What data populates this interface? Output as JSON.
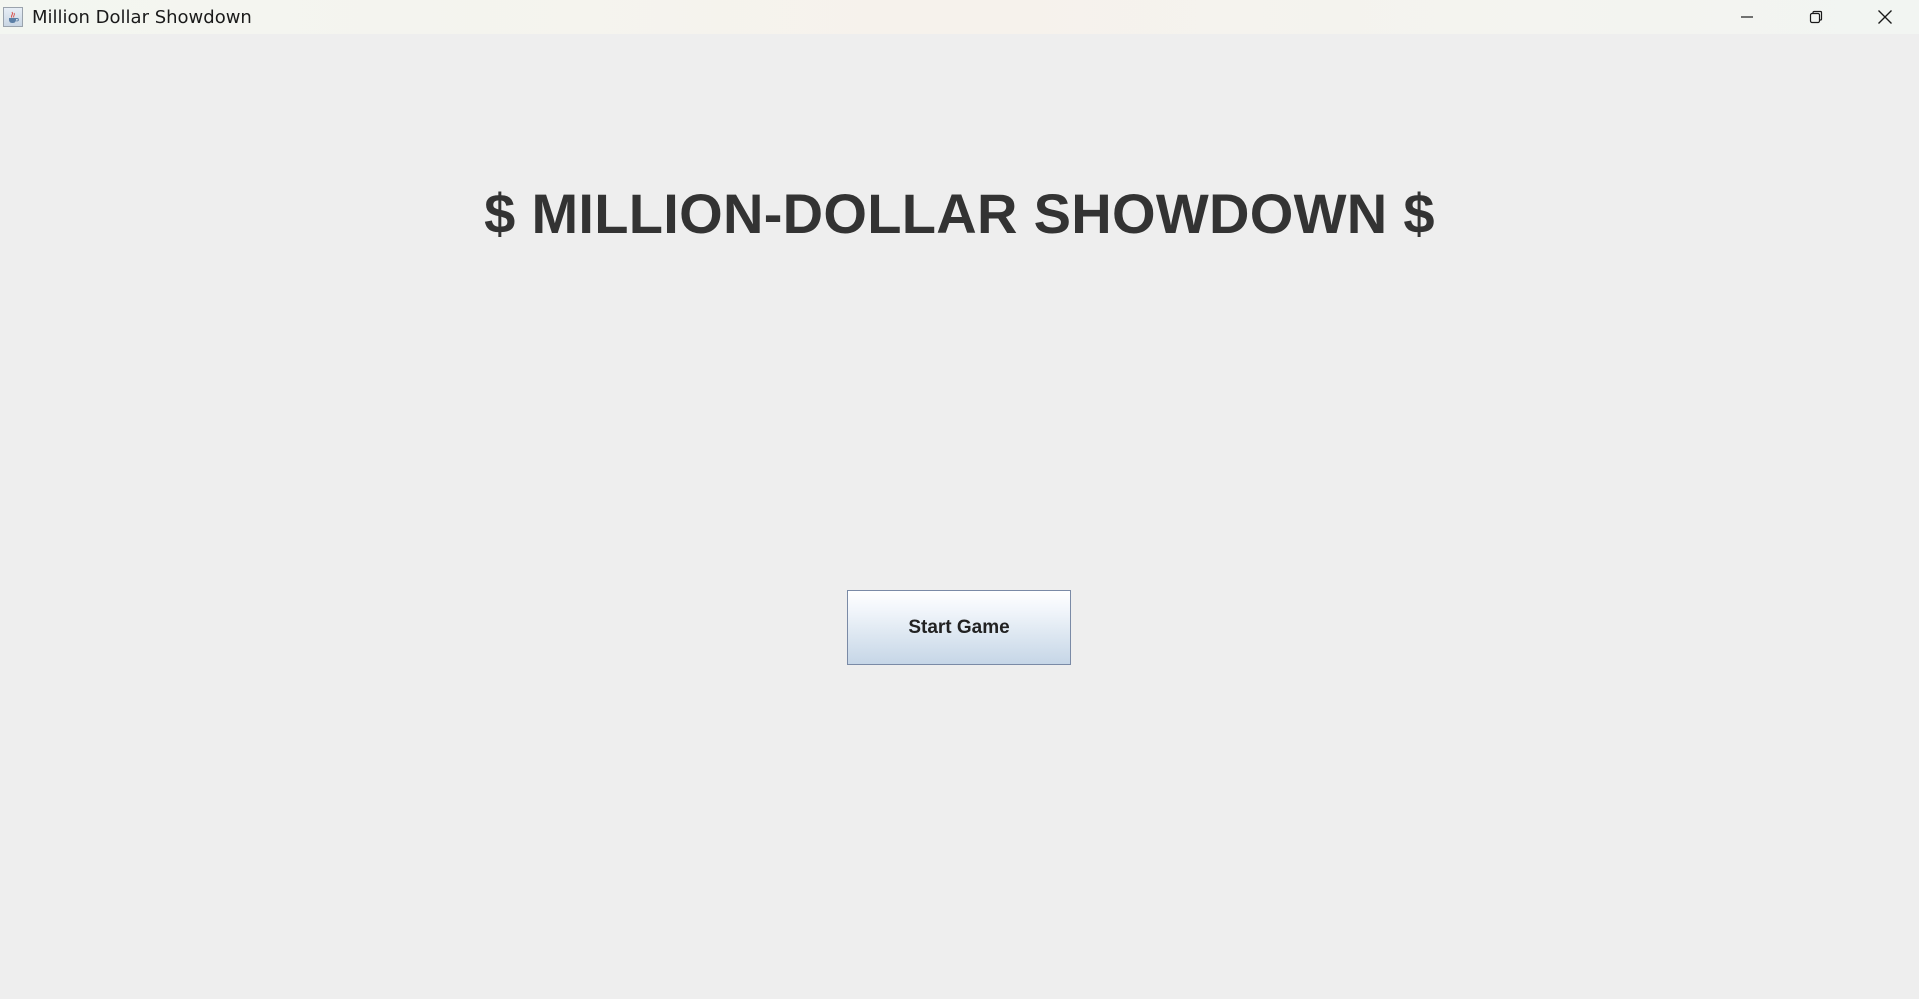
{
  "window": {
    "title": "Million Dollar Showdown",
    "icon": "java-cup-icon",
    "controls": [
      "minimize-icon",
      "restore-icon",
      "close-icon"
    ]
  },
  "main": {
    "heading": "$ MILLION-DOLLAR SHOWDOWN $",
    "start_button_label": "Start Game"
  },
  "colors": {
    "background": "#eeeeee",
    "heading": "#333333",
    "button_border": "#7a8aa6"
  }
}
